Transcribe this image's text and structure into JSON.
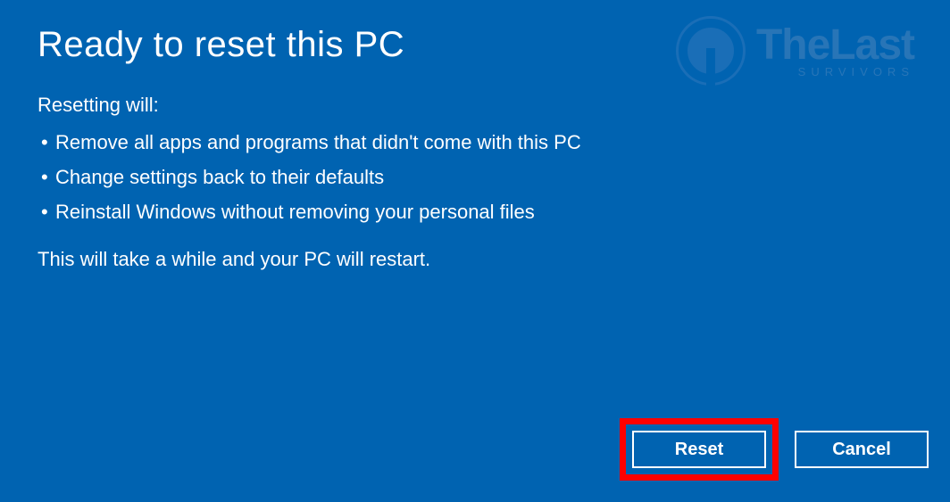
{
  "title": "Ready to reset this PC",
  "subtitle": "Resetting will:",
  "bullets": {
    "0": "Remove all apps and programs that didn't come with this PC",
    "1": "Change settings back to their defaults",
    "2": "Reinstall Windows without removing your personal files"
  },
  "note": "This will take a while and your PC will restart.",
  "buttons": {
    "reset": "Reset",
    "cancel": "Cancel"
  },
  "watermark": {
    "main": "TheLast",
    "sub": "SURVIVORS"
  },
  "colors": {
    "background": "#0063b1",
    "text": "#ffffff",
    "highlight": "#ff0000"
  }
}
